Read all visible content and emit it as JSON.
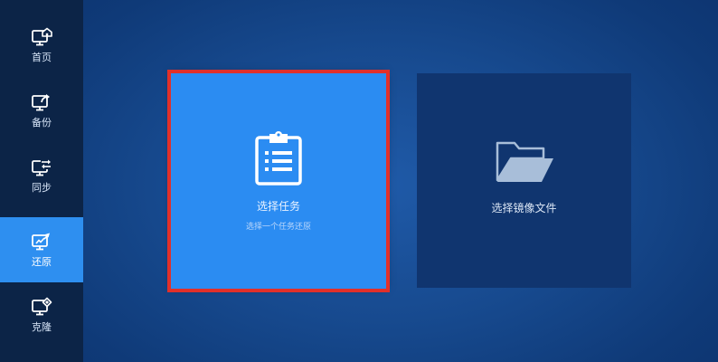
{
  "sidebar": {
    "items": [
      {
        "label": "首页",
        "icon": "home-monitor-icon",
        "active": false
      },
      {
        "label": "备份",
        "icon": "backup-monitor-icon",
        "active": false
      },
      {
        "label": "同步",
        "icon": "sync-monitor-icon",
        "active": false
      },
      {
        "label": "还原",
        "icon": "restore-monitor-icon",
        "active": true
      },
      {
        "label": "克隆",
        "icon": "clone-monitor-icon",
        "active": false
      }
    ]
  },
  "main": {
    "cards": [
      {
        "title": "选择任务",
        "subtitle": "选择一个任务还原",
        "icon": "clipboard-list-icon",
        "highlighted": true
      },
      {
        "title": "选择镜像文件",
        "icon": "open-folder-icon",
        "highlighted": false
      }
    ]
  },
  "colors": {
    "sidebar_bg": "#0c2447",
    "active_item": "#2e8ff0",
    "card_primary": "#2b8cf2",
    "card_secondary": "#10356f",
    "highlight_border": "#e1302a"
  }
}
